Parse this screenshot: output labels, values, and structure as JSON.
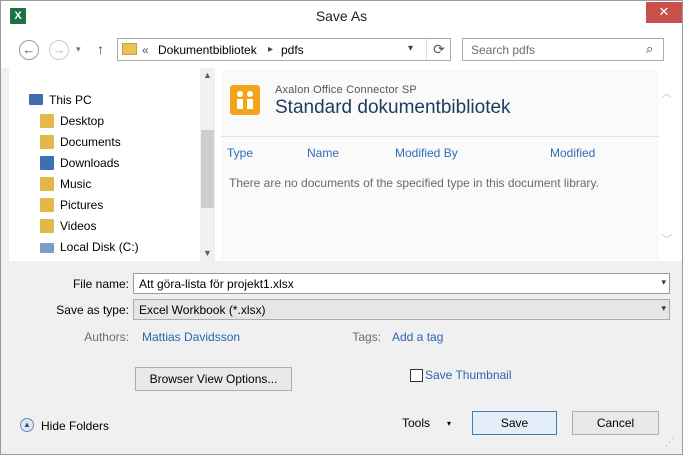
{
  "window": {
    "title": "Save As",
    "app_icon_letter": "X",
    "close_glyph": "✕"
  },
  "nav": {
    "back_glyph": "←",
    "forward_glyph": "→",
    "recent_glyph": "▾",
    "up_glyph": "↑",
    "breadcrumb_sep_left": "«",
    "breadcrumb": [
      "Dokumentbibliotek",
      "pdfs"
    ],
    "breadcrumb_sep": "▸",
    "address_dropdown_glyph": "▾",
    "refresh_glyph": "⟳",
    "search_placeholder": "Search pdfs",
    "search_icon_glyph": "⌕"
  },
  "tree": {
    "items": [
      {
        "label": "This PC",
        "icon": "computer-icon",
        "color": "#3f6fb0"
      },
      {
        "label": "Desktop",
        "icon": "desktop-folder-icon",
        "color": "#e3b84a"
      },
      {
        "label": "Documents",
        "icon": "documents-folder-icon",
        "color": "#e3b84a"
      },
      {
        "label": "Downloads",
        "icon": "downloads-folder-icon",
        "color": "#3f6fb0"
      },
      {
        "label": "Music",
        "icon": "music-folder-icon",
        "color": "#e3b84a"
      },
      {
        "label": "Pictures",
        "icon": "pictures-folder-icon",
        "color": "#e3b84a"
      },
      {
        "label": "Videos",
        "icon": "videos-folder-icon",
        "color": "#e3b84a"
      },
      {
        "label": "Local Disk (C:)",
        "icon": "local-disk-icon",
        "color": "#7a9cc8"
      }
    ],
    "scroll_up_glyph": "▲",
    "scroll_down_glyph": "▼"
  },
  "library": {
    "brand": "Axalon Office Connector SP",
    "title": "Standard dokumentbibliotek",
    "columns": [
      "Type",
      "Name",
      "Modified By",
      "Modified"
    ],
    "empty_message": "There are no documents of the specified type in this document library.",
    "scroll_up_glyph": "︿",
    "scroll_down_glyph": "﹀"
  },
  "form": {
    "file_name_label": "File name:",
    "file_name_value": "Att göra-lista för projekt1.xlsx",
    "save_type_label": "Save as type:",
    "save_type_value": "Excel Workbook (*.xlsx)",
    "dropdown_glyph": "▾",
    "authors_label": "Authors:",
    "authors_value": "Mattias Davidsson",
    "tags_label": "Tags:",
    "tags_value": "Add a tag",
    "browser_view_options": "Browser View Options...",
    "save_thumbnail_label": "Save Thumbnail",
    "save_thumbnail_checked": false
  },
  "footer": {
    "hide_folders": "Hide Folders",
    "hide_folders_glyph": "▲",
    "tools": "Tools",
    "tools_glyph": "▾",
    "save": "Save",
    "cancel": "Cancel",
    "grip_glyph": "⋰"
  },
  "colors": {
    "accent": "#2a66b0",
    "close": "#c7504b",
    "excel": "#1e7145",
    "brand": "#f2a51b"
  }
}
